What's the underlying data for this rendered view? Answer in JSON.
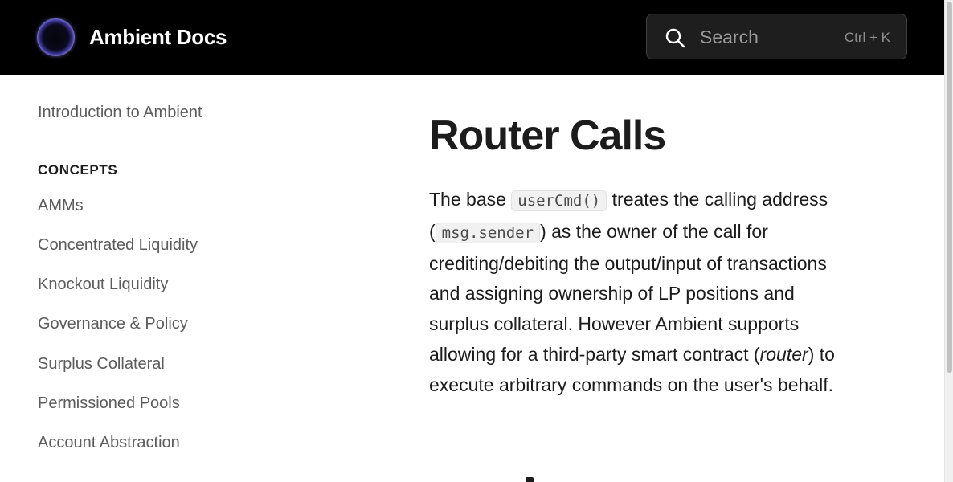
{
  "header": {
    "site_title": "Ambient Docs",
    "logo_icon": "ambient-ring-logo",
    "search": {
      "placeholder": "Search",
      "shortcut": "Ctrl + K",
      "icon": "search-icon"
    }
  },
  "sidebar": {
    "intro_item": "Introduction to Ambient",
    "section_title": "CONCEPTS",
    "items": [
      "AMMs",
      "Concentrated Liquidity",
      "Knockout Liquidity",
      "Governance & Policy",
      "Surplus Collateral",
      "Permissioned Pools",
      "Account Abstraction"
    ]
  },
  "main": {
    "title": "Router Calls",
    "paragraph": {
      "p1": "The base ",
      "code1": "userCmd()",
      "p2": " treates the calling address (",
      "code2": "msg.sender",
      "p3": ") as the owner of the call for crediting/debiting the output/input of transactions and assigning ownership of LP positions and surplus collateral. However Ambient supports allowing for a third-party smart contract (",
      "em": "router",
      "p4": ") to execute arbitrary commands on the user's behalf."
    }
  },
  "colors": {
    "header_bg": "#000000",
    "text": "#1c1c1c",
    "nav_text": "#5c5c5c",
    "code_bg": "#f1f1f1"
  }
}
